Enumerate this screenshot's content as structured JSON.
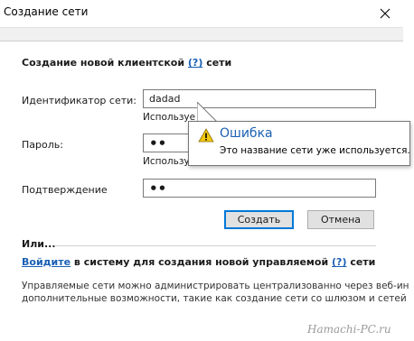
{
  "window": {
    "title": "Создание сети"
  },
  "form": {
    "section_title": "Создание новой клиентской",
    "section_title_help": "(?)",
    "section_title_suffix": "сети",
    "network_id_label": "Идентификатор сети:",
    "network_id_value": "dadad",
    "network_id_hint": "Используе",
    "password_label": "Пароль:",
    "password_value": "••",
    "password_hint": "Используе",
    "confirm_label": "Подтверждение",
    "confirm_value": "••",
    "create_button": "Создать",
    "cancel_button": "Отмена"
  },
  "alternative": {
    "or_label": "Или...",
    "signin_link": "Войдите",
    "signin_text": "в систему для создания новой управляемой",
    "signin_help": "(?)",
    "signin_suffix": "сети",
    "desc_line1": "Управляемые сети можно администрировать централизованно через веб-ин",
    "desc_line2": "дополнительные возможности, такие как создание сети со шлюзом и сетей"
  },
  "tooltip": {
    "title": "Ошибка",
    "message": "Это название сети уже используется.",
    "icon": "warning-icon"
  },
  "watermark": "Hamachi-PC.ru",
  "colors": {
    "link": "#1a5fb4",
    "accent_border": "#0078d7",
    "warning": "#f2c811"
  }
}
